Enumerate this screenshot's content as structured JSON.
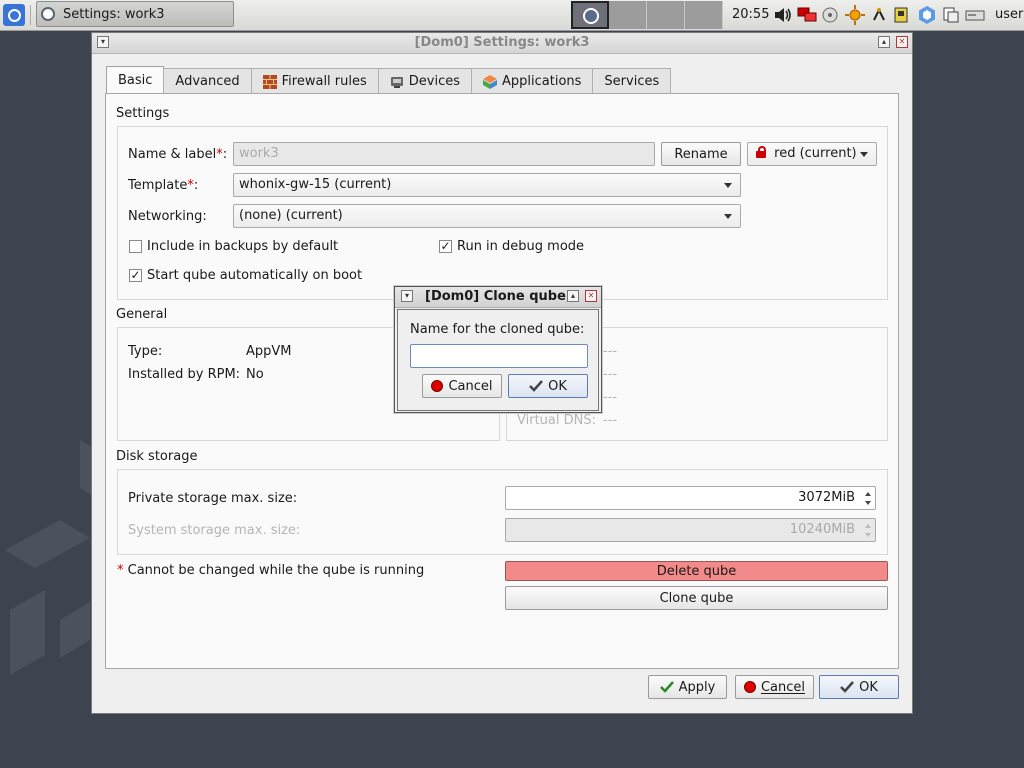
{
  "taskbar": {
    "task_label": "Settings: work3",
    "clock": "20:55",
    "user": "user",
    "workspaces": 4,
    "active_workspace": 1
  },
  "window": {
    "title": "[Dom0] Settings: work3",
    "tabs": [
      {
        "label": "Basic",
        "icon": ""
      },
      {
        "label": "Advanced",
        "icon": ""
      },
      {
        "label": "Firewall rules",
        "icon": "brick-wall-icon"
      },
      {
        "label": "Devices",
        "icon": "device-icon"
      },
      {
        "label": "Applications",
        "icon": "applications-icon"
      },
      {
        "label": "Services",
        "icon": ""
      }
    ],
    "active_tab": "Basic"
  },
  "settings": {
    "section_title": "Settings",
    "name_label": "Name & label",
    "name_value": "work3",
    "rename_button": "Rename",
    "label_value": "red (current)",
    "template_label": "Template",
    "template_value": "whonix-gw-15 (current)",
    "networking_label": "Networking:",
    "networking_value": "(none) (current)",
    "include_backups_label": "Include in backups by default",
    "include_backups_checked": false,
    "debug_mode_label": "Run in debug mode",
    "debug_mode_checked": true,
    "autostart_label": "Start qube automatically on boot",
    "autostart_checked": true
  },
  "general": {
    "section_title": "General",
    "type_label": "Type:",
    "type_value": "AppVM",
    "rpm_label": "Installed by RPM:",
    "rpm_value": "No",
    "net_placeholder": "---",
    "virtual_dns_label": "Virtual DNS:",
    "virtual_dns_value": "---"
  },
  "disk": {
    "section_title": "Disk storage",
    "private_label": "Private storage max. size:",
    "private_value": "3072MiB",
    "system_label": "System storage max. size:",
    "system_value": "10240MiB"
  },
  "footer_note": {
    "asterisk": "*",
    "text": "Cannot be changed while the qube is running"
  },
  "actions": {
    "delete_qube": "Delete qube",
    "clone_qube": "Clone qube",
    "apply": "Apply",
    "cancel": "Cancel",
    "ok": "OK"
  },
  "dialog": {
    "title": "[Dom0] Clone qube",
    "prompt": "Name for the cloned qube:",
    "input_value": "",
    "cancel": "Cancel",
    "ok": "OK"
  },
  "colors": {
    "accent": "#3874d8",
    "danger": "#f28a8a",
    "required": "#cc0000"
  }
}
